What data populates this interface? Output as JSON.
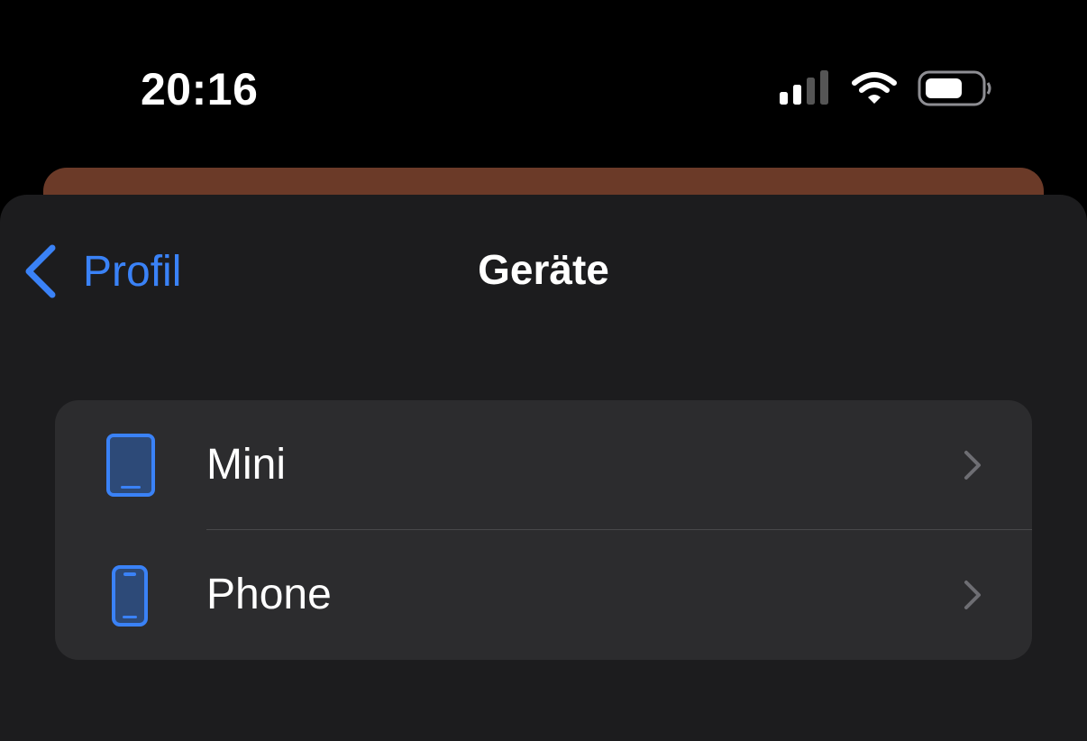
{
  "status_bar": {
    "time": "20:16",
    "icons": [
      "cellular-signal-icon",
      "wifi-icon",
      "battery-icon"
    ]
  },
  "nav": {
    "back_label": "Profil",
    "title": "Geräte"
  },
  "devices": [
    {
      "label": "Mini",
      "icon": "tablet-icon"
    },
    {
      "label": "Phone",
      "icon": "phone-icon"
    }
  ],
  "colors": {
    "accent": "#3a82f7",
    "background": "#1c1c1e",
    "card": "#2c2c2e",
    "behind_sheet": "#6b3a28"
  }
}
